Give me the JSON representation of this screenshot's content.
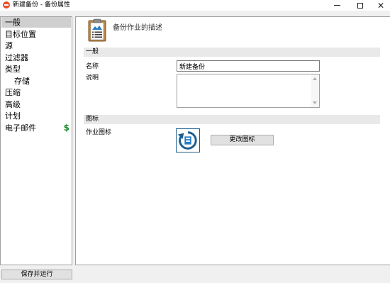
{
  "window": {
    "title": "新建备份 - 备份属性",
    "app_icon": "app-logo-icon",
    "controls": [
      "minimize-icon",
      "maximize-icon",
      "close-icon"
    ]
  },
  "sidebar": {
    "items": [
      {
        "label": "一般",
        "selected": true
      },
      {
        "label": "目标位置"
      },
      {
        "label": "源"
      },
      {
        "label": "过滤器"
      },
      {
        "label": "类型"
      },
      {
        "label": "存储",
        "indent": true
      },
      {
        "label": "压缩"
      },
      {
        "label": "高级"
      },
      {
        "label": "计划"
      },
      {
        "label": "电子邮件",
        "badge": "$"
      }
    ]
  },
  "footer": {
    "save_run_label": "保存并运行"
  },
  "main": {
    "header_icon": "clipboard-icon",
    "description_title": "备份作业的描述",
    "sections": {
      "general": "一般",
      "icon": "图标"
    },
    "fields": {
      "name_label": "名称",
      "name_value": "新建备份",
      "description_label": "说明",
      "description_value": "",
      "job_icon_label": "作业图标"
    },
    "change_icon_label": "更改图标"
  },
  "colors": {
    "selection": "#cfcfcf",
    "section_bar": "#e9e9e9",
    "badge": "#1b8a2a",
    "icon_blue": "#1f5f8f",
    "app_icon": "#e8502a"
  }
}
